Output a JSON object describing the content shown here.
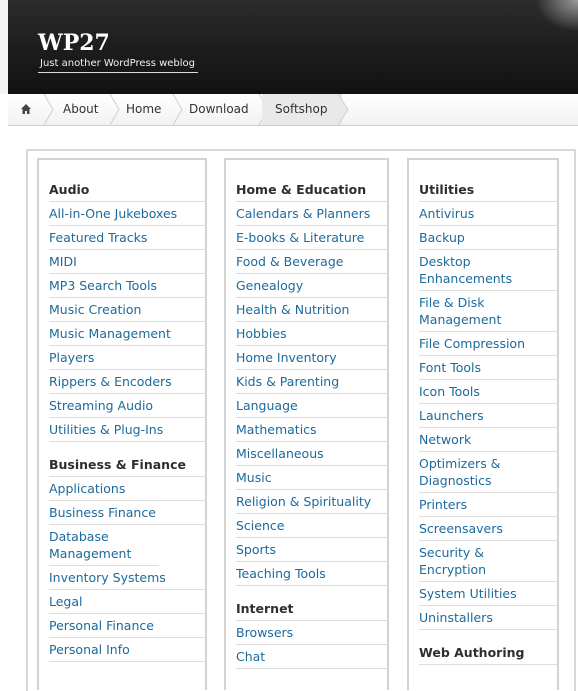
{
  "site": {
    "title": "WP27",
    "tagline": "Just another WordPress weblog"
  },
  "nav": {
    "items": [
      {
        "label": "About"
      },
      {
        "label": "Home"
      },
      {
        "label": "Download"
      },
      {
        "label": "Softshop"
      }
    ],
    "active": "Softshop",
    "home_icon": "home-icon"
  },
  "columns": [
    {
      "groups": [
        {
          "title": "Audio",
          "items": [
            "All-in-One Jukeboxes",
            "Featured Tracks",
            "MIDI",
            "MP3 Search Tools",
            "Music Creation",
            "Music Management",
            "Players",
            "Rippers & Encoders",
            "Streaming Audio",
            "Utilities & Plug-Ins"
          ]
        },
        {
          "title": "Business & Finance",
          "items": [
            "Applications",
            "Business Finance",
            "Database Management",
            "Inventory Systems",
            "Legal",
            "Personal Finance",
            "Personal Info"
          ]
        }
      ]
    },
    {
      "groups": [
        {
          "title": "Home & Education",
          "items": [
            "Calendars & Planners",
            "E-books & Literature",
            "Food & Beverage",
            "Genealogy",
            "Health & Nutrition",
            "Hobbies",
            "Home Inventory",
            "Kids & Parenting",
            "Language",
            "Mathematics",
            "Miscellaneous",
            "Music",
            "Religion & Spirituality",
            "Science",
            "Sports",
            "Teaching Tools"
          ]
        },
        {
          "title": "Internet",
          "items": [
            "Browsers",
            "Chat"
          ]
        }
      ]
    },
    {
      "groups": [
        {
          "title": "Utilities",
          "items": [
            "Antivirus",
            "Backup",
            "Desktop Enhancements",
            "File & Disk Management",
            "File Compression",
            "Font Tools",
            "Icon Tools",
            "Launchers",
            "Network",
            "Optimizers & Diagnostics",
            "Printers",
            "Screensavers",
            "Security & Encryption",
            "System Utilities",
            "Uninstallers"
          ]
        },
        {
          "title": "Web Authoring",
          "items": []
        }
      ]
    }
  ],
  "colors": {
    "link": "#1c6a9c",
    "header_bg": "#1b1b1b",
    "heading": "#2e2e2e"
  }
}
